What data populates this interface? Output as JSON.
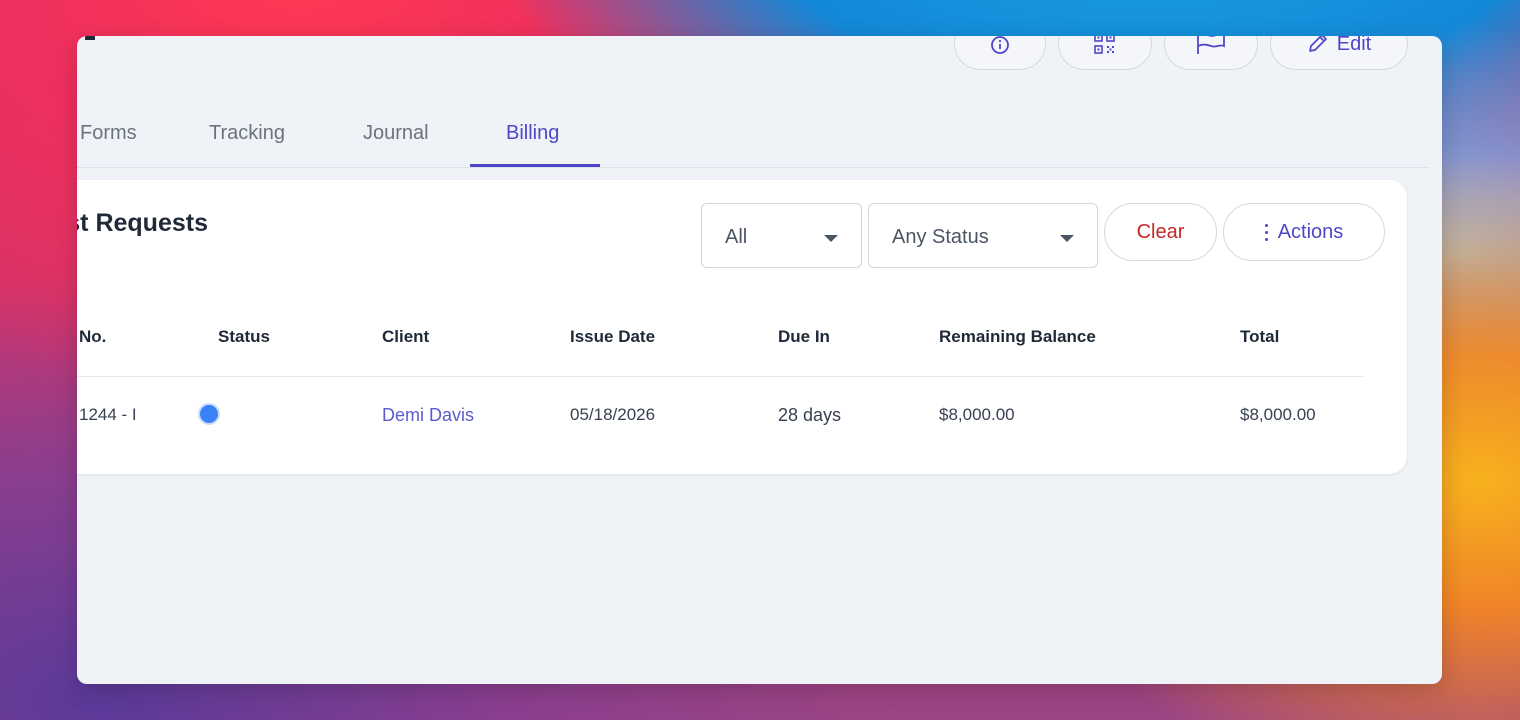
{
  "header": {
    "actions": [
      {
        "name": "info-icon"
      },
      {
        "name": "qr-code-icon"
      },
      {
        "name": "flag-icon"
      },
      {
        "name": "pencil-icon",
        "label": "Edit"
      }
    ]
  },
  "tabs": [
    {
      "label": "Forms",
      "active": false
    },
    {
      "label": "Tracking",
      "active": false
    },
    {
      "label": "Journal",
      "active": false
    },
    {
      "label": "Billing",
      "active": true
    }
  ],
  "panel": {
    "title": "ust Requests",
    "filter_type": {
      "value": "All"
    },
    "filter_status": {
      "value": "Any Status"
    },
    "clear_label": "Clear",
    "actions_label": "Actions"
  },
  "table": {
    "columns": [
      "No.",
      "Status",
      "Client",
      "Issue Date",
      "Due In",
      "Remaining Balance",
      "Total"
    ],
    "rows": [
      {
        "no": "1244 - I",
        "status_color": "#3b82f6",
        "client": "Demi Davis",
        "issue_date": "05/18/2026",
        "due_in": "28 days",
        "remaining_balance": "$8,000.00",
        "total": "$8,000.00"
      }
    ]
  },
  "colors": {
    "accent": "#4f46c8",
    "danger": "#c62828",
    "status_dot": "#3b82f6"
  }
}
